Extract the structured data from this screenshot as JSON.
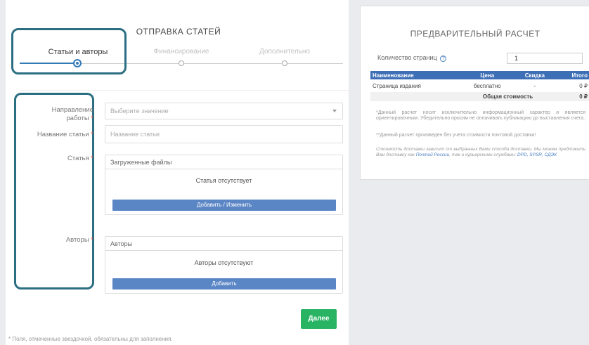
{
  "form": {
    "title": "ОТПРАВКА СТАТЕЙ",
    "steps": [
      {
        "label": "Статьи и авторы",
        "active": true
      },
      {
        "label": "Финансирование",
        "active": false
      },
      {
        "label": "Дополнительно",
        "active": false
      }
    ],
    "fields": {
      "direction_label_1": "Направление",
      "direction_label_2": "работы",
      "direction_placeholder": "Выберите значение",
      "title_label": "Название статьи",
      "title_placeholder": "Название статьи",
      "article_label": "Статья",
      "article_box_header": "Загруженные файлы",
      "article_empty": "Статья отсутствует",
      "article_button": "Добавить / Изменить",
      "authors_label": "Авторы",
      "authors_box_header": "Авторы",
      "authors_empty": "Авторы отсутствуют",
      "authors_button": "Добавить",
      "required_mark": "*"
    },
    "next_button": "Далее",
    "footnote": "* Поля, отмеченные звездочкой, обязательны для заполнения."
  },
  "estimate": {
    "title": "ПРЕДВАРИТЕЛЬНЫЙ РАСЧЕТ",
    "pages_label": "Количество страниц",
    "help_icon": "?",
    "pages_value": "1",
    "table": {
      "headers": [
        "Наименование",
        "Цена",
        "Скидка",
        "Итого"
      ],
      "row": [
        "Страница издания",
        "бесплатно",
        "-",
        "0 ₽"
      ],
      "total_label": "Общая стоимость",
      "total_value": "0 ₽"
    },
    "note1": "*Данный расчет носит исключительно информационный характер и является ориентировочным. Убедительно просим не оплачивать публикацию до выставления счета.",
    "note2": "**Данный расчет произведен без учета стоимости почтовой доставки!",
    "note3_text": "Стоимость доставки зависит от выбранных Вами способа доставки. Мы можем предложить Вам доставку как",
    "note3_link1": "Почтой России",
    "note3_mid": ", так и курьерскими службами:",
    "note3_link2": "DPD, SPSR, СДЭК"
  },
  "colors": {
    "accent": "#337ab7",
    "button_blue": "#5b86c5",
    "button_green": "#28b463",
    "highlight": "#2c6e82",
    "table_header": "#3d6fb6"
  }
}
